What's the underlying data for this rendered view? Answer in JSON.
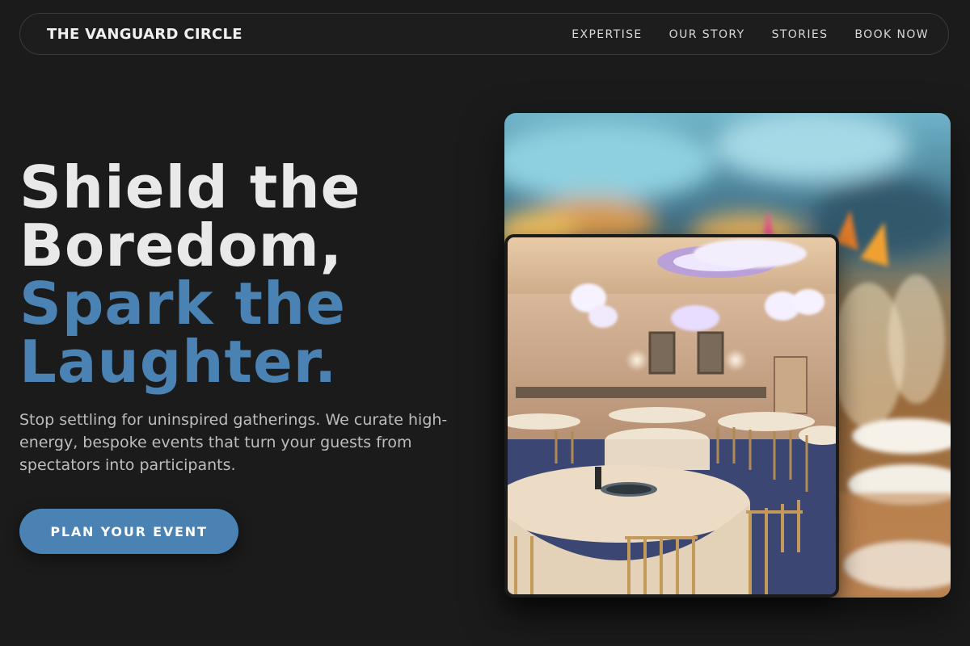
{
  "nav": {
    "brand": "THE VANGUARD CIRCLE",
    "links": [
      "EXPERTISE",
      "OUR STORY",
      "STORIES",
      "BOOK NOW"
    ]
  },
  "hero": {
    "headline_line1": "Shield the",
    "headline_line2": "Boredom,",
    "headline_accent_line1": "Spark the",
    "headline_accent_line2": "Laughter.",
    "subtext": "Stop settling for uninspired gatherings. We curate high-energy, bespoke events that turn your guests from spectators into participants.",
    "cta_label": "PLAN YOUR EVENT"
  },
  "colors": {
    "background": "#1b1b1c",
    "accent": "#4a82b4",
    "headline": "#e9e9e9",
    "body_text": "#bdbdbd"
  }
}
